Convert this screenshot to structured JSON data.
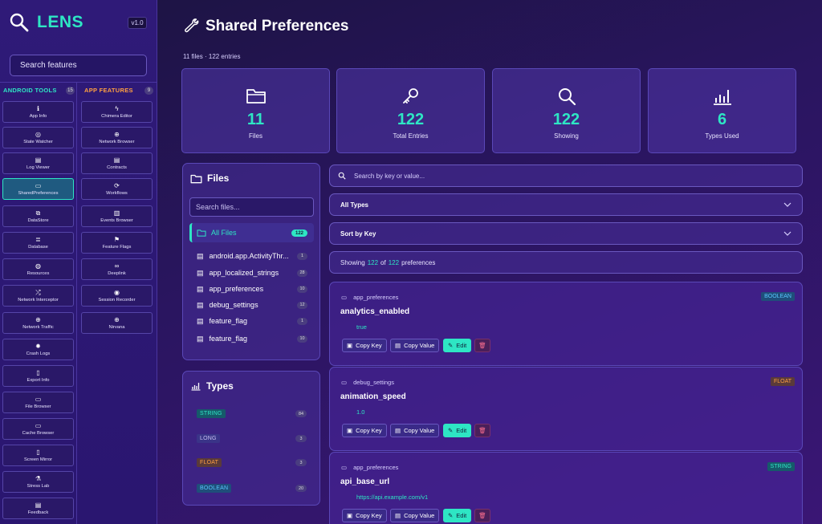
{
  "app": {
    "name": "LENS",
    "version": "v1.0",
    "search_placeholder": "Search features"
  },
  "sidebar": {
    "android_tools": {
      "label": "ANDROID TOOLS",
      "count": "15",
      "color": "#2ee6c4",
      "items": [
        "App Info",
        "State Watcher",
        "Log Viewer",
        "SharedPreferences",
        "DataStore",
        "Database",
        "Resources",
        "Network Interceptor",
        "Network Traffic",
        "Crash Logs",
        "Export Info",
        "File Browser",
        "Cache Browser",
        "Screen Mirror",
        "Stress Lab",
        "Feedback"
      ]
    },
    "app_features": {
      "label": "APP FEATURES",
      "count": "9",
      "color": "#ffa040",
      "items": [
        "Chimera Editor",
        "Network Browser",
        "Contracts",
        "Workflows",
        "Events Browser",
        "Feature Flags",
        "Deeplink",
        "Session Recorder",
        "Nirvana"
      ]
    }
  },
  "page": {
    "title": "Shared Preferences",
    "subtitle": "11 files · 122 entries"
  },
  "stats": [
    {
      "value": "11",
      "label": "Files",
      "icon": "folder-icon"
    },
    {
      "value": "122",
      "label": "Total Entries",
      "icon": "key-icon"
    },
    {
      "value": "122",
      "label": "Showing",
      "icon": "search-icon"
    },
    {
      "value": "6",
      "label": "Types Used",
      "icon": "bar-chart-icon"
    }
  ],
  "files_panel": {
    "title": "Files",
    "search_placeholder": "Search files...",
    "all_files": {
      "label": "All Files",
      "count": "122"
    },
    "items": [
      {
        "name": "android.app.ActivityThr...",
        "count": "1"
      },
      {
        "name": "app_localized_strings",
        "count": "28"
      },
      {
        "name": "app_preferences",
        "count": "10"
      },
      {
        "name": "debug_settings",
        "count": "12"
      },
      {
        "name": "feature_flag",
        "count": "1"
      },
      {
        "name": "feature_flag",
        "count": "10"
      }
    ]
  },
  "types_panel": {
    "title": "Types",
    "items": [
      {
        "name": "STRING",
        "count": "84"
      },
      {
        "name": "LONG",
        "count": "3"
      },
      {
        "name": "FLOAT",
        "count": "3"
      },
      {
        "name": "BOOLEAN",
        "count": "20"
      }
    ]
  },
  "filters": {
    "search_placeholder": "Search by key or value...",
    "type_select": "All Types",
    "sort_select": "Sort by Key",
    "showing_prefix": "Showing",
    "showing_count": "122",
    "showing_of": "of",
    "showing_total": "122",
    "showing_suffix": "preferences"
  },
  "entries": [
    {
      "file": "app_preferences",
      "key": "analytics_enabled",
      "value": "true",
      "type": "BOOLEAN"
    },
    {
      "file": "debug_settings",
      "key": "animation_speed",
      "value": "1.0",
      "type": "FLOAT"
    },
    {
      "file": "app_preferences",
      "key": "api_base_url",
      "value": "https://api.example.com/v1",
      "type": "STRING"
    }
  ],
  "actions": {
    "copy_key": "Copy Key",
    "copy_value": "Copy Value",
    "edit": "Edit"
  }
}
